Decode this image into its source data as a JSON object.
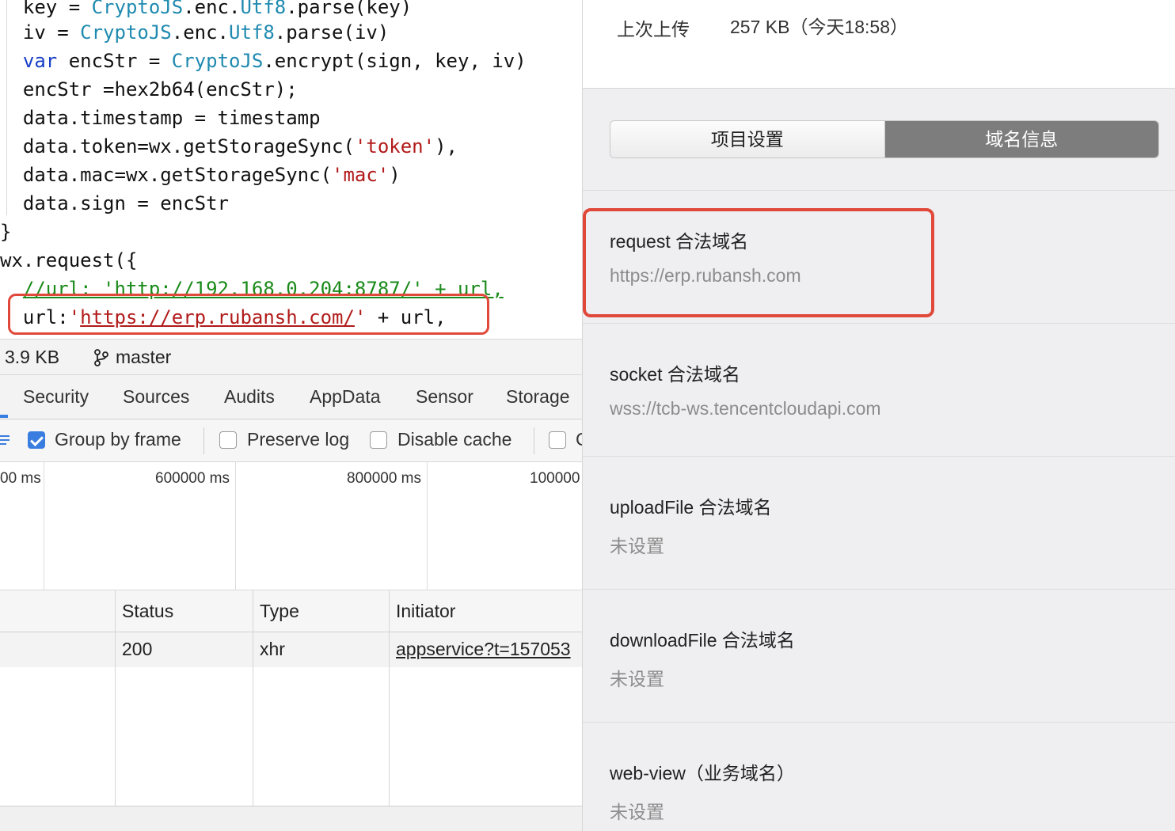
{
  "code": {
    "lines": [
      [
        {
          "t": "  key = "
        },
        {
          "t": "CryptoJS",
          "c": "tk-cls"
        },
        {
          "t": ".enc."
        },
        {
          "t": "Utf8",
          "c": "tk-cls"
        },
        {
          "t": ".parse(key)"
        }
      ],
      [
        {
          "t": "  iv = "
        },
        {
          "t": "CryptoJS",
          "c": "tk-cls"
        },
        {
          "t": ".enc."
        },
        {
          "t": "Utf8",
          "c": "tk-cls"
        },
        {
          "t": ".parse(iv)"
        }
      ],
      [
        {
          "t": "  "
        },
        {
          "t": "var",
          "c": "tk-kw"
        },
        {
          "t": " encStr = "
        },
        {
          "t": "CryptoJS",
          "c": "tk-cls"
        },
        {
          "t": ".encrypt(sign, key, iv)"
        }
      ],
      [
        {
          "t": "  encStr =hex2b64(encStr);"
        }
      ],
      [
        {
          "t": "  data.timestamp = timestamp"
        }
      ],
      [
        {
          "t": "  data.token=wx.getStorageSync("
        },
        {
          "t": "'token'",
          "c": "tk-str"
        },
        {
          "t": "),"
        }
      ],
      [
        {
          "t": "  data.mac=wx.getStorageSync("
        },
        {
          "t": "'mac'",
          "c": "tk-str"
        },
        {
          "t": ")"
        }
      ],
      [
        {
          "t": "  data.sign = encStr"
        }
      ],
      [
        {
          "t": "}"
        }
      ],
      [
        {
          "t": "wx.request({"
        }
      ],
      [
        {
          "t": "  "
        },
        {
          "t": "//url: 'http://192.168.0.204:8787/' + url,",
          "c": "tk-cmt"
        }
      ],
      [
        {
          "t": "  url:"
        },
        {
          "t": "'",
          "c": "tk-str"
        },
        {
          "t": "https://erp.rubansh.com/",
          "c": "tk-url"
        },
        {
          "t": "'",
          "c": "tk-str"
        },
        {
          "t": " + url,"
        }
      ]
    ]
  },
  "statusbar": {
    "size": "3.9 KB",
    "branch": "master",
    "branch_icon": "git-branch-icon"
  },
  "devtools_tabs": [
    "Security",
    "Sources",
    "Audits",
    "AppData",
    "Sensor",
    "Storage"
  ],
  "toolbar": {
    "group_by_frame": "Group by frame",
    "preserve_log": "Preserve log",
    "disable_cache": "Disable cache",
    "truncated": "C"
  },
  "timeline": {
    "labels": [
      "00 ms",
      "600000 ms",
      "800000 ms",
      "100000"
    ]
  },
  "table": {
    "headers": {
      "status": "Status",
      "type": "Type",
      "initiator": "Initiator"
    },
    "row": {
      "status": "200",
      "type": "xhr",
      "initiator": "appservice?t=157053"
    }
  },
  "project": {
    "last_upload_label": "上次上传",
    "last_upload_value": "257 KB（今天18:58）",
    "tabs": {
      "settings": "项目设置",
      "domain_info": "域名信息"
    },
    "domains": [
      {
        "title": "request 合法域名",
        "value": "https://erp.rubansh.com"
      },
      {
        "title": "socket 合法域名",
        "value": "wss://tcb-ws.tencentcloudapi.com"
      },
      {
        "title": "uploadFile 合法域名",
        "value": "未设置"
      },
      {
        "title": "downloadFile 合法域名",
        "value": "未设置"
      },
      {
        "title": "web-view（业务域名）",
        "value": "未设置"
      }
    ]
  },
  "colors": {
    "highlight_red": "#e0483a",
    "active_tab_gray": "#7d7d7d",
    "accent_blue": "#3a7de0"
  }
}
